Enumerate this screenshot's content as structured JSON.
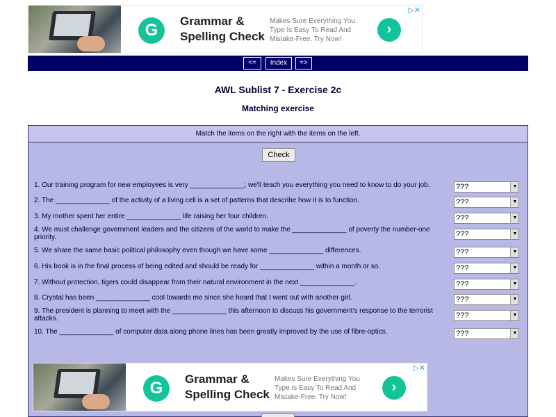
{
  "ad": {
    "title": "Grammar & Spelling Check",
    "description": "Makes Sure Everything You Type Is Easy To Read And Mistake-Free. Try Now!",
    "logo_letter": "G",
    "go_symbol": "›",
    "adchoices_symbol": "▷✕"
  },
  "nav": {
    "prev": "<=",
    "index": "Index",
    "next": "=>"
  },
  "page": {
    "title": "AWL Sublist 7 - Exercise 2c",
    "subtitle": "Matching exercise"
  },
  "exercise": {
    "instructions": "Match the items on the right with the items on the left.",
    "check_label": "Check",
    "questions": [
      {
        "text": "1. Our training program for new employees is very ______________; we'll teach you everything you need to know to do your job.",
        "answer": "???"
      },
      {
        "text": "2. The ______________ of the activity of a living cell is a set of patterns that describe how it is to function.",
        "answer": "???"
      },
      {
        "text": "3. My mother spent her entire ______________ life raising her four children.",
        "answer": "???"
      },
      {
        "text": "4. We must challenge government leaders and the citizens of the world to make the ______________ of poverty the number-one priority.",
        "answer": "???"
      },
      {
        "text": "5. We share the same basic political philosophy even though we have some ______________ differences.",
        "answer": "???"
      },
      {
        "text": "6. His book is in the final process of being edited and should be ready for ______________ within a month or so.",
        "answer": "???"
      },
      {
        "text": "7. Without protection, tigers could disappear from their natural environment in the next ______________.",
        "answer": "???"
      },
      {
        "text": "8. Crystal has been ______________ cool towards me since she heard that I went out with another girl.",
        "answer": "???"
      },
      {
        "text": "9. The president is planning to meet with the ______________ this afternoon to discuss his government's response to the terrorist attacks.",
        "answer": "???"
      },
      {
        "text": "10. The ______________ of computer data along phone lines has been greatly improved by the use of fibre-optics.",
        "answer": "???"
      }
    ]
  },
  "colors": {
    "navbar": "#000066",
    "panel": "#b8b8e6",
    "brand_green": "#15c39a"
  }
}
